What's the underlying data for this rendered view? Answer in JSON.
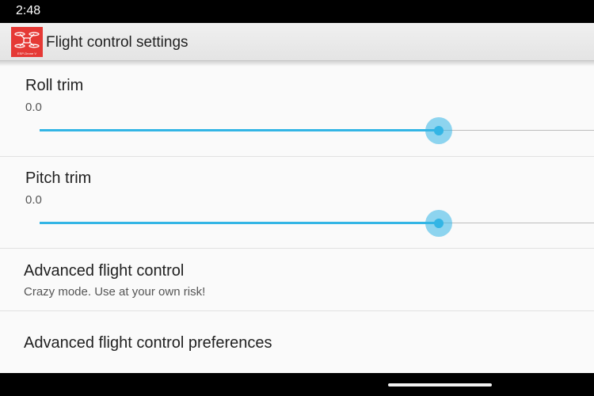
{
  "status_bar": {
    "time": "2:48"
  },
  "action_bar": {
    "title": "Flight control settings",
    "app_icon": {
      "name": "drone-app-icon",
      "caption": "ESP-Drone V",
      "color": "#e53935"
    }
  },
  "preferences": {
    "roll_trim": {
      "title": "Roll trim",
      "value_label": "0.0",
      "slider_fraction": 0.72
    },
    "pitch_trim": {
      "title": "Pitch trim",
      "value_label": "0.0",
      "slider_fraction": 0.72
    },
    "advanced_flight_control": {
      "title": "Advanced flight control",
      "summary": "Crazy mode. Use at your own risk!"
    },
    "advanced_flight_control_preferences": {
      "title": "Advanced flight control preferences"
    }
  },
  "colors": {
    "accent": "#33b5e5",
    "background": "#fafafa",
    "action_bar": "#eaeaea"
  }
}
